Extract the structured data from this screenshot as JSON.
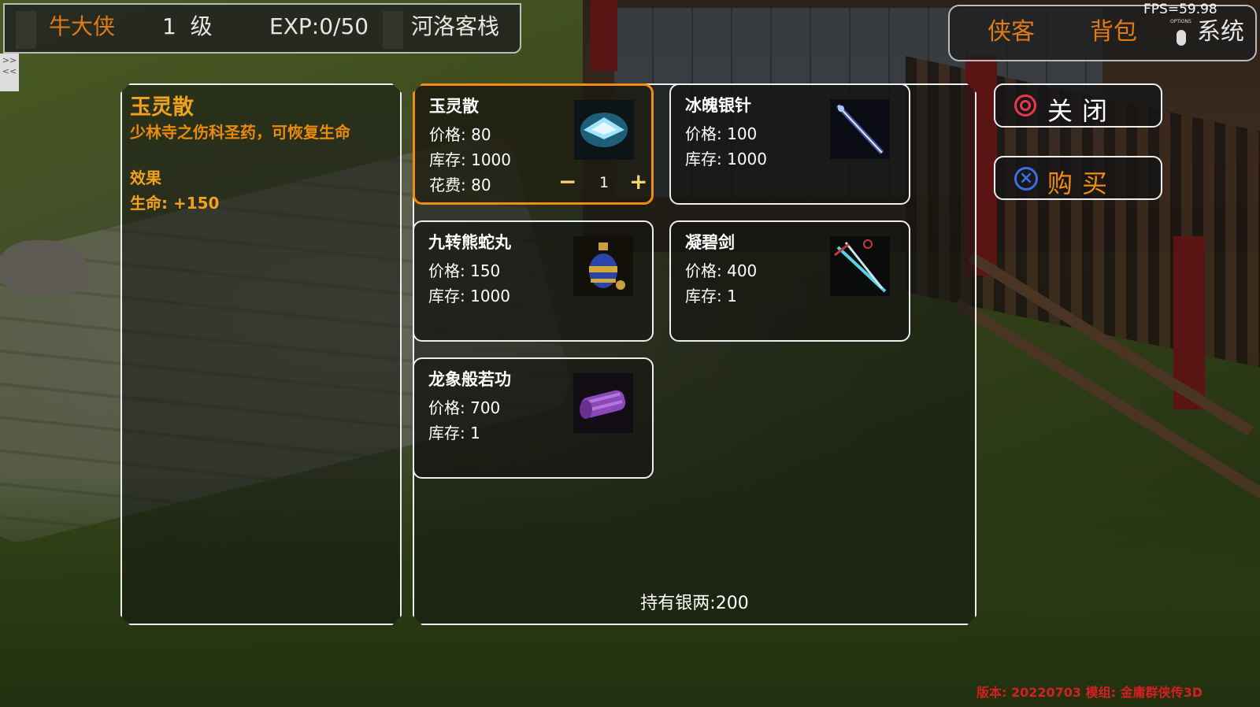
{
  "hud": {
    "player_name": "牛大侠",
    "level_num": "1",
    "level_label": "级",
    "exp": "EXP:0/50",
    "location": "河洛客栈",
    "fps": "FPS=59.98",
    "menu": {
      "heroes": "侠客",
      "bag": "背包",
      "system": "系统",
      "options_label": "OPTIONS"
    },
    "side_tab": ">>\n<<"
  },
  "detail": {
    "name": "玉灵散",
    "description": "少林寺之伤科圣药，可恢复生命",
    "effect_label": "效果",
    "effect_value": "生命: +150"
  },
  "shop": {
    "items": [
      {
        "name": "玉灵散",
        "price": "价格: 80",
        "stock": "库存: 1000",
        "cost": "花费: 80",
        "qty": "1",
        "icon": "jade-powder-icon",
        "selected": true
      },
      {
        "name": "冰魄银针",
        "price": "价格: 100",
        "stock": "库存: 1000",
        "icon": "ice-needle-icon"
      },
      {
        "name": "九转熊蛇丸",
        "price": "价格: 150",
        "stock": "库存: 1000",
        "icon": "medicine-vase-icon"
      },
      {
        "name": "凝碧剑",
        "price": "价格: 400",
        "stock": "库存: 1",
        "icon": "sword-icon"
      },
      {
        "name": "龙象般若功",
        "price": "价格: 700",
        "stock": "库存: 1",
        "icon": "scroll-icon"
      }
    ],
    "silver": "持有银两:200"
  },
  "buttons": {
    "close": "关闭",
    "buy": "购买"
  },
  "version": "版本: 20220703 模组: 金庸群侠传3D",
  "colors": {
    "accent": "#f08c10",
    "name": "#e07a18",
    "circle": "#e8374a",
    "cross": "#3a6fe0"
  }
}
